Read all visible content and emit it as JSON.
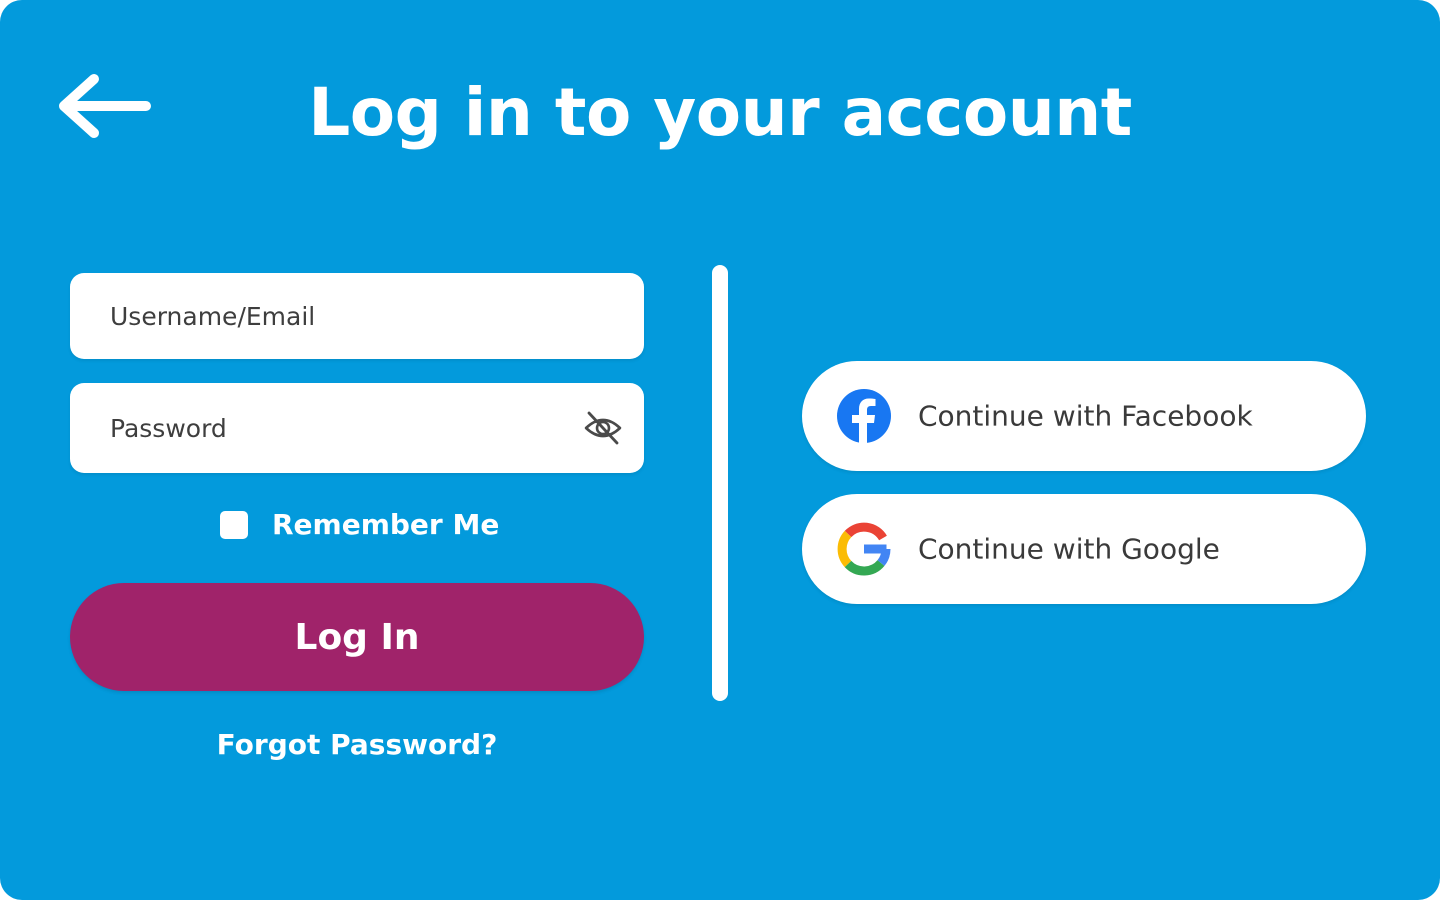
{
  "header": {
    "back_icon": "arrow-left-icon",
    "title": "Log in to your account"
  },
  "form": {
    "username_placeholder": "Username/Email",
    "password_placeholder": "Password",
    "password_toggle_icon": "eye-off-icon",
    "remember_label": "Remember Me",
    "remember_checked": false,
    "login_label": "Log In",
    "forgot_label": "Forgot Password?"
  },
  "social": {
    "facebook_label": "Continue with Facebook",
    "facebook_icon": "facebook-icon",
    "google_label": "Continue with Google",
    "google_icon": "google-icon"
  },
  "colors": {
    "background": "#039ADC",
    "primary_button": "#A0236A",
    "facebook_blue": "#1877F2",
    "google_blue": "#4285F4",
    "google_red": "#EA4335",
    "google_yellow": "#FBBC05",
    "google_green": "#34A853"
  }
}
